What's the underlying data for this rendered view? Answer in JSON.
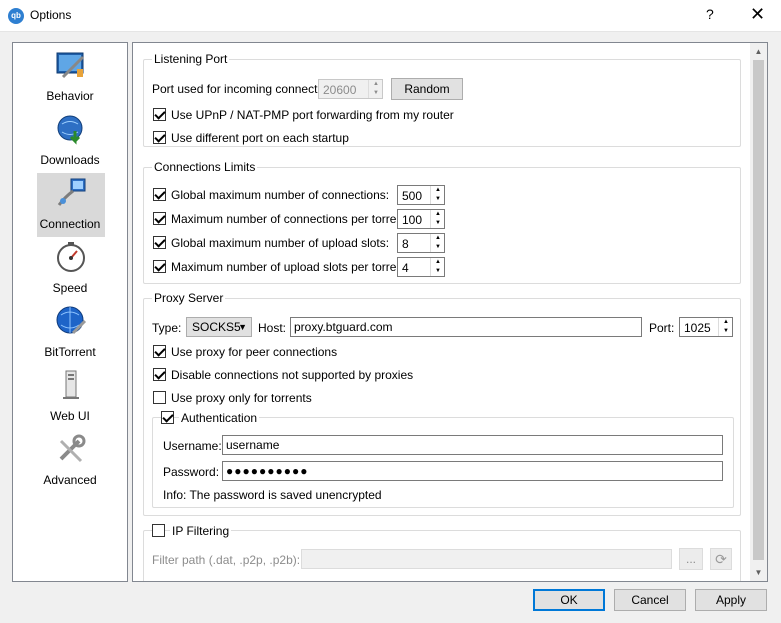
{
  "window": {
    "title": "Options",
    "icon": "qbittorrent-logo",
    "help": "?",
    "close": "✕"
  },
  "sidebar": {
    "items": [
      {
        "label": "Behavior",
        "icon": "behavior-icon"
      },
      {
        "label": "Downloads",
        "icon": "downloads-icon"
      },
      {
        "label": "Connection",
        "icon": "connection-icon",
        "selected": true
      },
      {
        "label": "Speed",
        "icon": "speed-icon"
      },
      {
        "label": "BitTorrent",
        "icon": "bittorrent-icon"
      },
      {
        "label": "Web UI",
        "icon": "webui-icon"
      },
      {
        "label": "Advanced",
        "icon": "advanced-icon"
      }
    ]
  },
  "listening_port": {
    "title": "Listening Port",
    "port_label": "Port used for incoming connections:",
    "port_value": "20600",
    "random_label": "Random",
    "upnp_label": "Use UPnP / NAT-PMP port forwarding from my router",
    "upnp_checked": true,
    "diff_port_label": "Use different port on each startup",
    "diff_port_checked": true
  },
  "connection_limits": {
    "title": "Connections Limits",
    "rows": [
      {
        "label": "Global maximum number of connections:",
        "value": "500",
        "checked": true
      },
      {
        "label": "Maximum number of connections per torrent:",
        "value": "100",
        "checked": true
      },
      {
        "label": "Global maximum number of upload slots:",
        "value": "8",
        "checked": true
      },
      {
        "label": "Maximum number of upload slots per torrent:",
        "value": "4",
        "checked": true
      }
    ]
  },
  "proxy": {
    "title": "Proxy Server",
    "type_label": "Type:",
    "type_value": "SOCKS5",
    "host_label": "Host:",
    "host_value": "proxy.btguard.com",
    "port_label": "Port:",
    "port_value": "1025",
    "peer_label": "Use proxy for peer connections",
    "disable_label": "Disable connections not supported by proxies",
    "torrents_only_label": "Use proxy only for torrents",
    "auth_label": "Authentication",
    "username_label": "Username:",
    "username_value": "username",
    "password_label": "Password:",
    "password_value": "●●●●●●●●●●",
    "info": "Info: The password is saved unencrypted"
  },
  "ip_filtering": {
    "title": "IP Filtering",
    "path_label": "Filter path (.dat, .p2p, .p2b):",
    "browse_label": "...",
    "reload_icon": "reload-icon"
  },
  "footer": {
    "ok": "OK",
    "cancel": "Cancel",
    "apply": "Apply"
  }
}
